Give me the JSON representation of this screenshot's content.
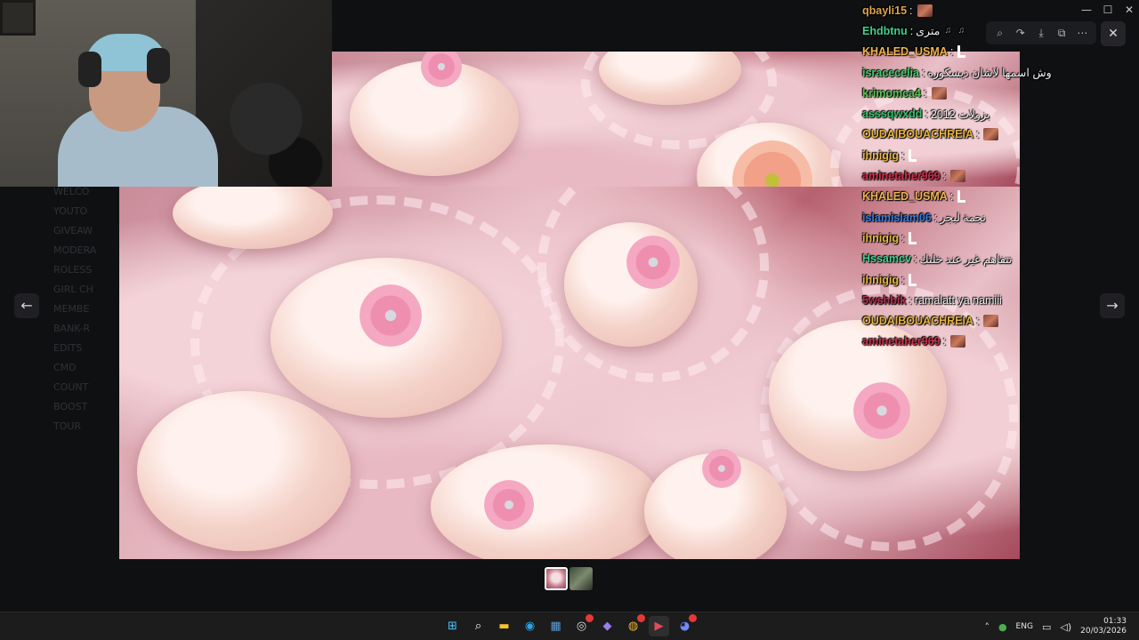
{
  "window": {
    "title": "",
    "controls": {
      "minimize": "—",
      "maximize": "☐",
      "close": "✕"
    }
  },
  "viewer": {
    "toolbar": [
      {
        "name": "zoom-icon",
        "glyph": "⌕"
      },
      {
        "name": "forward-icon",
        "glyph": "↷"
      },
      {
        "name": "download-icon",
        "glyph": "⤓"
      },
      {
        "name": "open-external-icon",
        "glyph": "⧉"
      },
      {
        "name": "more-icon",
        "glyph": "⋯"
      }
    ],
    "close": "✕",
    "prev": "←",
    "next": "→"
  },
  "chat": [
    {
      "user": "qbayli15",
      "color": "#e0a34c",
      "text": "",
      "emote": true
    },
    {
      "user": "Ehdbtnu",
      "color": "#3fd18f",
      "text": "مترى",
      "emote": false,
      "badges": 2
    },
    {
      "user": "KHALED_USMA",
      "color": "#f0b34a",
      "text": "",
      "bar": true
    },
    {
      "user": "isracecelia",
      "color": "#45d06d",
      "text": "وش اسمها لاشان ديسكوره",
      "emote": false
    },
    {
      "user": "krimomca4",
      "color": "#56c94f",
      "text": "",
      "emote": true
    },
    {
      "user": "asssqwxdd",
      "color": "#39c06a",
      "text": "بزولات 2012",
      "emote": false
    },
    {
      "user": "OUDAIBOUACHREIA",
      "color": "#e8b33a",
      "text": "",
      "emote": true
    },
    {
      "user": "ihnigig",
      "color": "#e7b84a",
      "text": "",
      "bar": true
    },
    {
      "user": "aminetaher969",
      "color": "#d0304a",
      "text": "",
      "emote": true
    },
    {
      "user": "KHALED_USMA",
      "color": "#f0b34a",
      "text": "",
      "bar": true
    },
    {
      "user": "islamislam06",
      "color": "#3c7bd6",
      "text": "نجمة لبجر",
      "emote": false
    },
    {
      "user": "ihnigig",
      "color": "#e7b84a",
      "text": "",
      "bar": true
    },
    {
      "user": "Hssamcv",
      "color": "#3fd18f",
      "text": "تتفاهم غير عند خلتك",
      "emote": false
    },
    {
      "user": "ihnigig",
      "color": "#e7b84a",
      "text": "",
      "bar": true
    },
    {
      "user": "5wshbik",
      "color": "#b2304e",
      "text": "ramalatt ya namiii",
      "emote": false
    },
    {
      "user": "OUDAIBOUACHREIA",
      "color": "#e8b33a",
      "text": "",
      "emote": true
    },
    {
      "user": "aminetaher969",
      "color": "#d0304a",
      "text": "",
      "emote": true
    }
  ],
  "taskbar": {
    "apps": [
      {
        "name": "start-icon",
        "glyph": "⊞",
        "color": "#4cc2ff"
      },
      {
        "name": "search-icon",
        "glyph": "⌕",
        "color": "#ffffff"
      },
      {
        "name": "file-explorer-icon",
        "glyph": "▬",
        "color": "#f4c430"
      },
      {
        "name": "edge-icon",
        "glyph": "◉",
        "color": "#2fa3e6"
      },
      {
        "name": "store-icon",
        "glyph": "▦",
        "color": "#5b9bd5"
      },
      {
        "name": "obs-icon",
        "glyph": "◎",
        "color": "#dcdcdc",
        "badge": true
      },
      {
        "name": "app-icon",
        "glyph": "◆",
        "color": "#9a7cf0"
      },
      {
        "name": "chrome-icon",
        "glyph": "◍",
        "color": "#e8b33a",
        "badge": true
      },
      {
        "name": "media-player-icon",
        "glyph": "▶",
        "color": "#e54a5a",
        "active": true
      },
      {
        "name": "discord-icon",
        "glyph": "◕",
        "color": "#7289ff",
        "badge": true
      }
    ],
    "tray": {
      "lang": "ENG",
      "time": "01:33",
      "date": "20/03/2026"
    }
  },
  "background": {
    "channels": [
      "WELCO",
      "YOUTO",
      "GIVEAW",
      "MODERA",
      "ROLESS",
      "GIRL CH",
      "MEMBE",
      "BANK-R",
      "EDITS",
      "CMD",
      "COUNT",
      "BOOST",
      "TOUR"
    ]
  }
}
